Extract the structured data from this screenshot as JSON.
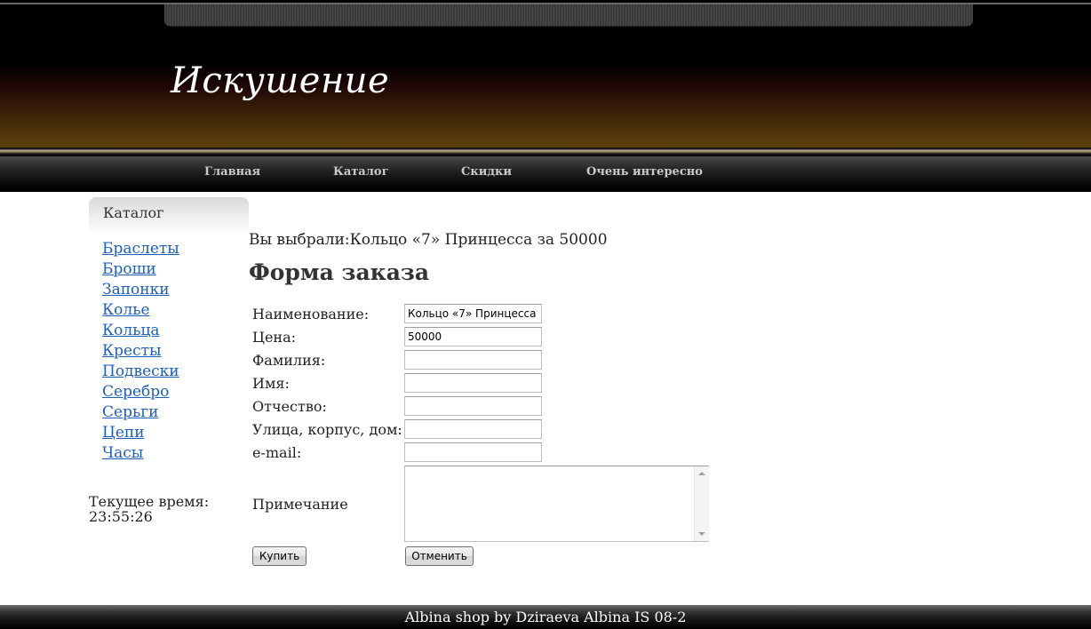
{
  "header": {
    "site_title": "Искушение"
  },
  "nav": {
    "items": [
      {
        "label": "Главная"
      },
      {
        "label": "Каталог"
      },
      {
        "label": "Скидки"
      },
      {
        "label": "Очень интересно"
      }
    ]
  },
  "sidebar": {
    "heading": "Каталог",
    "items": [
      {
        "label": "Браслеты"
      },
      {
        "label": "Броши"
      },
      {
        "label": "Запонки"
      },
      {
        "label": "Колье"
      },
      {
        "label": "Кольца"
      },
      {
        "label": "Кресты"
      },
      {
        "label": "Подвески"
      },
      {
        "label": "Серебро"
      },
      {
        "label": "Серьги"
      },
      {
        "label": "Цепи"
      },
      {
        "label": "Часы"
      }
    ],
    "clock_label": "Текущее время:",
    "clock_value": "23:55:26"
  },
  "main": {
    "selection_text": "Вы выбрали:Кольцо «7» Принцесса за 50000",
    "form_title": "Форма заказа",
    "fields": {
      "name": {
        "label": "Наименование:",
        "value": "Кольцо «7» Принцесса"
      },
      "price": {
        "label": "Цена:",
        "value": "50000"
      },
      "surname": {
        "label": "Фамилия:",
        "value": ""
      },
      "first_name": {
        "label": "Имя:",
        "value": ""
      },
      "patronymic": {
        "label": "Отчество:",
        "value": ""
      },
      "address": {
        "label": "Улица, корпус, дом:",
        "value": ""
      },
      "email": {
        "label": "e-mail:",
        "value": ""
      },
      "note": {
        "label": "Примечание",
        "value": ""
      }
    },
    "buy_button": "Купить",
    "cancel_button": "Отменить"
  },
  "footer": {
    "text": "Albina shop by Dziraeva Albina IS 08-2"
  },
  "colors": {
    "link": "#1f5fb7",
    "header_gold": "#5e420c",
    "nav_text": "#c9c9c9"
  }
}
